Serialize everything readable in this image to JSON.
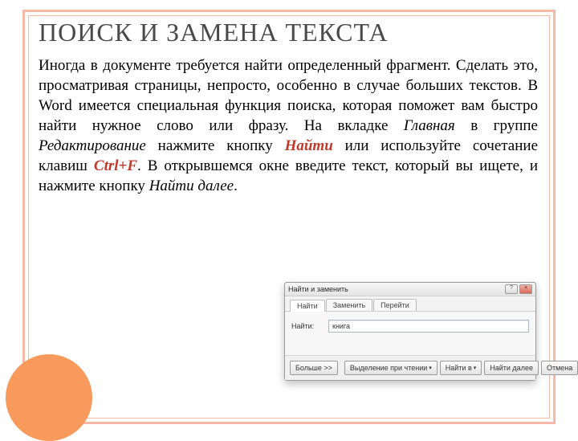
{
  "heading": "ПОИСК И ЗАМЕНА ТЕКСТА",
  "para": {
    "t1": "Иногда в документе требуется найти определенный фрагмент. Сделать это, просматривая страницы, непросто, особенно в случае больших текстов. В Word имеется специальная функция поиска, которая поможет вам быстро найти нужное слово или фразу. На вкладке ",
    "i1": "Главная",
    "t2": " в группе ",
    "i2": "Редактирование",
    "t3": " нажмите кнопку ",
    "b1": "Найти",
    "t4": " или используйте сочетание клавиш ",
    "b2": "Ctrl+F",
    "t5": ". В открывшемся окне введите текст, который вы ищете, и нажмите кнопку ",
    "i3": "Найти далее",
    "t6": "."
  },
  "dialog": {
    "title": "Найти и заменить",
    "tabs": {
      "find": "Найти",
      "replace": "Заменить",
      "goto": "Перейти"
    },
    "label_find": "Найти:",
    "input_value": "книга",
    "buttons": {
      "more": "Больше >>",
      "highlight": "Выделение при чтении",
      "find_in": "Найти в",
      "find_next": "Найти далее",
      "cancel": "Отмена"
    }
  }
}
